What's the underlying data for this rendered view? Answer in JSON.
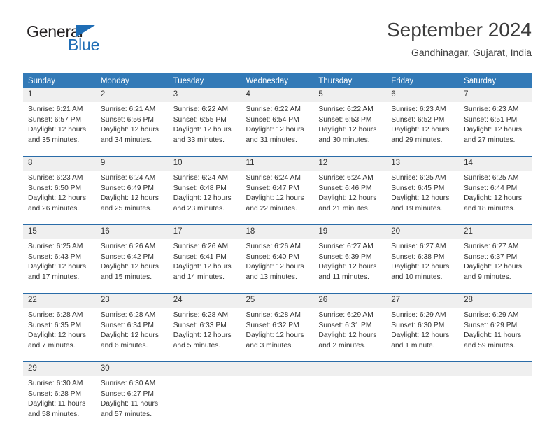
{
  "brand": {
    "name_top": "General",
    "name_bottom": "Blue",
    "triangle_color": "#1f6db5",
    "text_color": "#231f20"
  },
  "header": {
    "title": "September 2024",
    "subtitle": "Gandhinagar, Gujarat, India"
  },
  "theme": {
    "header_bg": "#337ab7",
    "header_text": "#ffffff",
    "daynum_bg": "#efefef",
    "week_rule": "#2a6ca8",
    "body_text": "#333333"
  },
  "calendar": {
    "weekday_headers": [
      "Sunday",
      "Monday",
      "Tuesday",
      "Wednesday",
      "Thursday",
      "Friday",
      "Saturday"
    ],
    "weeks": [
      [
        {
          "day": "1",
          "sunrise": "Sunrise: 6:21 AM",
          "sunset": "Sunset: 6:57 PM",
          "daylight1": "Daylight: 12 hours",
          "daylight2": "and 35 minutes."
        },
        {
          "day": "2",
          "sunrise": "Sunrise: 6:21 AM",
          "sunset": "Sunset: 6:56 PM",
          "daylight1": "Daylight: 12 hours",
          "daylight2": "and 34 minutes."
        },
        {
          "day": "3",
          "sunrise": "Sunrise: 6:22 AM",
          "sunset": "Sunset: 6:55 PM",
          "daylight1": "Daylight: 12 hours",
          "daylight2": "and 33 minutes."
        },
        {
          "day": "4",
          "sunrise": "Sunrise: 6:22 AM",
          "sunset": "Sunset: 6:54 PM",
          "daylight1": "Daylight: 12 hours",
          "daylight2": "and 31 minutes."
        },
        {
          "day": "5",
          "sunrise": "Sunrise: 6:22 AM",
          "sunset": "Sunset: 6:53 PM",
          "daylight1": "Daylight: 12 hours",
          "daylight2": "and 30 minutes."
        },
        {
          "day": "6",
          "sunrise": "Sunrise: 6:23 AM",
          "sunset": "Sunset: 6:52 PM",
          "daylight1": "Daylight: 12 hours",
          "daylight2": "and 29 minutes."
        },
        {
          "day": "7",
          "sunrise": "Sunrise: 6:23 AM",
          "sunset": "Sunset: 6:51 PM",
          "daylight1": "Daylight: 12 hours",
          "daylight2": "and 27 minutes."
        }
      ],
      [
        {
          "day": "8",
          "sunrise": "Sunrise: 6:23 AM",
          "sunset": "Sunset: 6:50 PM",
          "daylight1": "Daylight: 12 hours",
          "daylight2": "and 26 minutes."
        },
        {
          "day": "9",
          "sunrise": "Sunrise: 6:24 AM",
          "sunset": "Sunset: 6:49 PM",
          "daylight1": "Daylight: 12 hours",
          "daylight2": "and 25 minutes."
        },
        {
          "day": "10",
          "sunrise": "Sunrise: 6:24 AM",
          "sunset": "Sunset: 6:48 PM",
          "daylight1": "Daylight: 12 hours",
          "daylight2": "and 23 minutes."
        },
        {
          "day": "11",
          "sunrise": "Sunrise: 6:24 AM",
          "sunset": "Sunset: 6:47 PM",
          "daylight1": "Daylight: 12 hours",
          "daylight2": "and 22 minutes."
        },
        {
          "day": "12",
          "sunrise": "Sunrise: 6:24 AM",
          "sunset": "Sunset: 6:46 PM",
          "daylight1": "Daylight: 12 hours",
          "daylight2": "and 21 minutes."
        },
        {
          "day": "13",
          "sunrise": "Sunrise: 6:25 AM",
          "sunset": "Sunset: 6:45 PM",
          "daylight1": "Daylight: 12 hours",
          "daylight2": "and 19 minutes."
        },
        {
          "day": "14",
          "sunrise": "Sunrise: 6:25 AM",
          "sunset": "Sunset: 6:44 PM",
          "daylight1": "Daylight: 12 hours",
          "daylight2": "and 18 minutes."
        }
      ],
      [
        {
          "day": "15",
          "sunrise": "Sunrise: 6:25 AM",
          "sunset": "Sunset: 6:43 PM",
          "daylight1": "Daylight: 12 hours",
          "daylight2": "and 17 minutes."
        },
        {
          "day": "16",
          "sunrise": "Sunrise: 6:26 AM",
          "sunset": "Sunset: 6:42 PM",
          "daylight1": "Daylight: 12 hours",
          "daylight2": "and 15 minutes."
        },
        {
          "day": "17",
          "sunrise": "Sunrise: 6:26 AM",
          "sunset": "Sunset: 6:41 PM",
          "daylight1": "Daylight: 12 hours",
          "daylight2": "and 14 minutes."
        },
        {
          "day": "18",
          "sunrise": "Sunrise: 6:26 AM",
          "sunset": "Sunset: 6:40 PM",
          "daylight1": "Daylight: 12 hours",
          "daylight2": "and 13 minutes."
        },
        {
          "day": "19",
          "sunrise": "Sunrise: 6:27 AM",
          "sunset": "Sunset: 6:39 PM",
          "daylight1": "Daylight: 12 hours",
          "daylight2": "and 11 minutes."
        },
        {
          "day": "20",
          "sunrise": "Sunrise: 6:27 AM",
          "sunset": "Sunset: 6:38 PM",
          "daylight1": "Daylight: 12 hours",
          "daylight2": "and 10 minutes."
        },
        {
          "day": "21",
          "sunrise": "Sunrise: 6:27 AM",
          "sunset": "Sunset: 6:37 PM",
          "daylight1": "Daylight: 12 hours",
          "daylight2": "and 9 minutes."
        }
      ],
      [
        {
          "day": "22",
          "sunrise": "Sunrise: 6:28 AM",
          "sunset": "Sunset: 6:35 PM",
          "daylight1": "Daylight: 12 hours",
          "daylight2": "and 7 minutes."
        },
        {
          "day": "23",
          "sunrise": "Sunrise: 6:28 AM",
          "sunset": "Sunset: 6:34 PM",
          "daylight1": "Daylight: 12 hours",
          "daylight2": "and 6 minutes."
        },
        {
          "day": "24",
          "sunrise": "Sunrise: 6:28 AM",
          "sunset": "Sunset: 6:33 PM",
          "daylight1": "Daylight: 12 hours",
          "daylight2": "and 5 minutes."
        },
        {
          "day": "25",
          "sunrise": "Sunrise: 6:28 AM",
          "sunset": "Sunset: 6:32 PM",
          "daylight1": "Daylight: 12 hours",
          "daylight2": "and 3 minutes."
        },
        {
          "day": "26",
          "sunrise": "Sunrise: 6:29 AM",
          "sunset": "Sunset: 6:31 PM",
          "daylight1": "Daylight: 12 hours",
          "daylight2": "and 2 minutes."
        },
        {
          "day": "27",
          "sunrise": "Sunrise: 6:29 AM",
          "sunset": "Sunset: 6:30 PM",
          "daylight1": "Daylight: 12 hours",
          "daylight2": "and 1 minute."
        },
        {
          "day": "28",
          "sunrise": "Sunrise: 6:29 AM",
          "sunset": "Sunset: 6:29 PM",
          "daylight1": "Daylight: 11 hours",
          "daylight2": "and 59 minutes."
        }
      ],
      [
        {
          "day": "29",
          "sunrise": "Sunrise: 6:30 AM",
          "sunset": "Sunset: 6:28 PM",
          "daylight1": "Daylight: 11 hours",
          "daylight2": "and 58 minutes."
        },
        {
          "day": "30",
          "sunrise": "Sunrise: 6:30 AM",
          "sunset": "Sunset: 6:27 PM",
          "daylight1": "Daylight: 11 hours",
          "daylight2": "and 57 minutes."
        },
        {
          "day": "",
          "sunrise": "",
          "sunset": "",
          "daylight1": "",
          "daylight2": ""
        },
        {
          "day": "",
          "sunrise": "",
          "sunset": "",
          "daylight1": "",
          "daylight2": ""
        },
        {
          "day": "",
          "sunrise": "",
          "sunset": "",
          "daylight1": "",
          "daylight2": ""
        },
        {
          "day": "",
          "sunrise": "",
          "sunset": "",
          "daylight1": "",
          "daylight2": ""
        },
        {
          "day": "",
          "sunrise": "",
          "sunset": "",
          "daylight1": "",
          "daylight2": ""
        }
      ]
    ]
  }
}
